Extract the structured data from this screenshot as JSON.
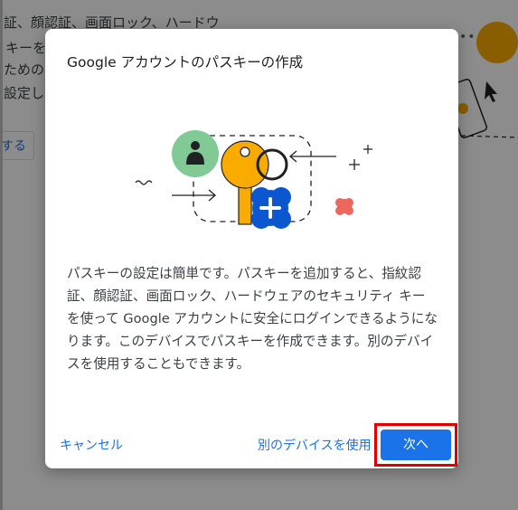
{
  "background": {
    "lines": [
      "証、顔認証、画面ロック、ハードウ",
      "キーを",
      "ための",
      "設定し"
    ],
    "button_label": "する"
  },
  "dialog": {
    "title": "Google アカウントのパスキーの作成",
    "body": "パスキーの設定は簡単です。パスキーを追加すると、指紋認証、顔認証、画面ロック、ハードウェアのセキュリティ キーを使って Google アカウントに安全にログインできるようになります。このデバイスでパスキーを作成できます。別のデバイスを使用することもできます。",
    "cancel_label": "キャンセル",
    "other_device_label": "別のデバイスを使用",
    "next_label": "次へ"
  },
  "colors": {
    "accent": "#1a73e8",
    "key": "#f9ab00",
    "badge_green": "#81c995",
    "highlight": "#e00000"
  }
}
